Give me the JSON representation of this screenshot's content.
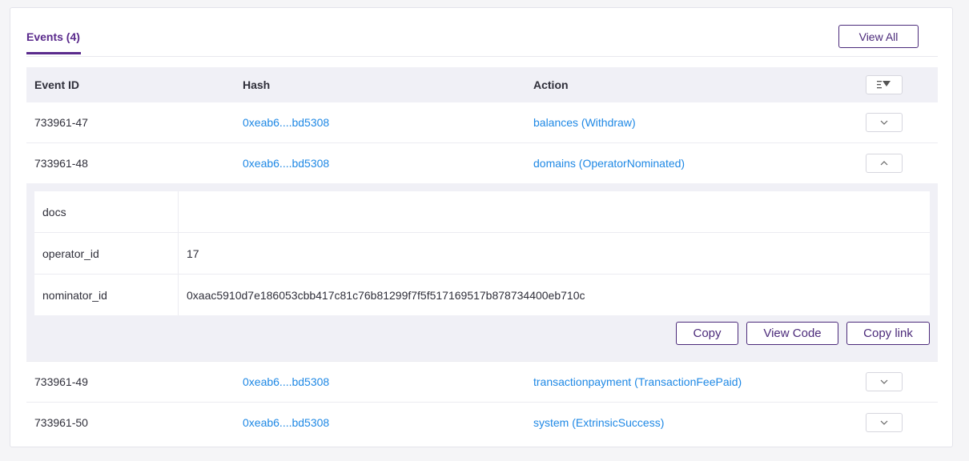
{
  "tabs": {
    "active_label": "Events (4)"
  },
  "header": {
    "view_all_label": "View All"
  },
  "table": {
    "columns": {
      "event_id": "Event ID",
      "hash": "Hash",
      "action": "Action"
    },
    "rows": [
      {
        "event_id": "733961-47",
        "hash": "0xeab6....bd5308",
        "action": "balances (Withdraw)",
        "expanded": false
      },
      {
        "event_id": "733961-48",
        "hash": "0xeab6....bd5308",
        "action": "domains (OperatorNominated)",
        "expanded": true
      },
      {
        "event_id": "733961-49",
        "hash": "0xeab6....bd5308",
        "action": "transactionpayment (TransactionFeePaid)",
        "expanded": false
      },
      {
        "event_id": "733961-50",
        "hash": "0xeab6....bd5308",
        "action": "system (ExtrinsicSuccess)",
        "expanded": false
      }
    ]
  },
  "details": {
    "params": [
      {
        "key": "docs",
        "value": ""
      },
      {
        "key": "operator_id",
        "value": "17"
      },
      {
        "key": "nominator_id",
        "value": "0xaac5910d7e186053cbb417c81c76b81299f7f5f517169517b878734400eb710c"
      }
    ],
    "copy_label": "Copy",
    "view_code_label": "View Code",
    "copy_link_label": "Copy link"
  },
  "colors": {
    "accent": "#4b2a7a",
    "link": "#1e88e5",
    "header_bg": "#f0f0f6"
  },
  "icons": {
    "filter": "filter-sort-icon",
    "expand": "chevron-down-icon",
    "collapse": "chevron-up-icon"
  }
}
